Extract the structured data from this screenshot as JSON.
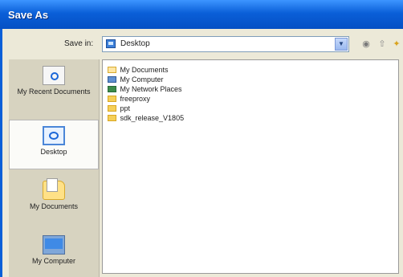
{
  "window": {
    "title": "Save As"
  },
  "toolbar": {
    "save_in_label": "Save in:",
    "location_value": "Desktop",
    "location_icon": "desktop-icon",
    "back_icon": "back-icon",
    "up_icon": "up-folder-icon",
    "new_folder_icon": "new-folder-icon"
  },
  "places_bar": [
    {
      "label": "My Recent Documents",
      "icon": "recent-documents-icon",
      "selected": false
    },
    {
      "label": "Desktop",
      "icon": "desktop-icon",
      "selected": true
    },
    {
      "label": "My Documents",
      "icon": "my-documents-icon",
      "selected": false
    },
    {
      "label": "My Computer",
      "icon": "my-computer-icon",
      "selected": false
    }
  ],
  "files": [
    {
      "label": "My Documents",
      "icon": "my-documents-icon"
    },
    {
      "label": "My Computer",
      "icon": "my-computer-icon"
    },
    {
      "label": "My Network Places",
      "icon": "network-places-icon"
    },
    {
      "label": "freeproxy",
      "icon": "folder-icon"
    },
    {
      "label": "ppt",
      "icon": "folder-icon"
    },
    {
      "label": "sdk_release_V1805",
      "icon": "folder-icon"
    }
  ],
  "colors": {
    "title_bar": "#0a5fd8",
    "window_bg": "#ece9d8",
    "places_bg": "#d7d3c0",
    "folder": "#f5cf58"
  }
}
